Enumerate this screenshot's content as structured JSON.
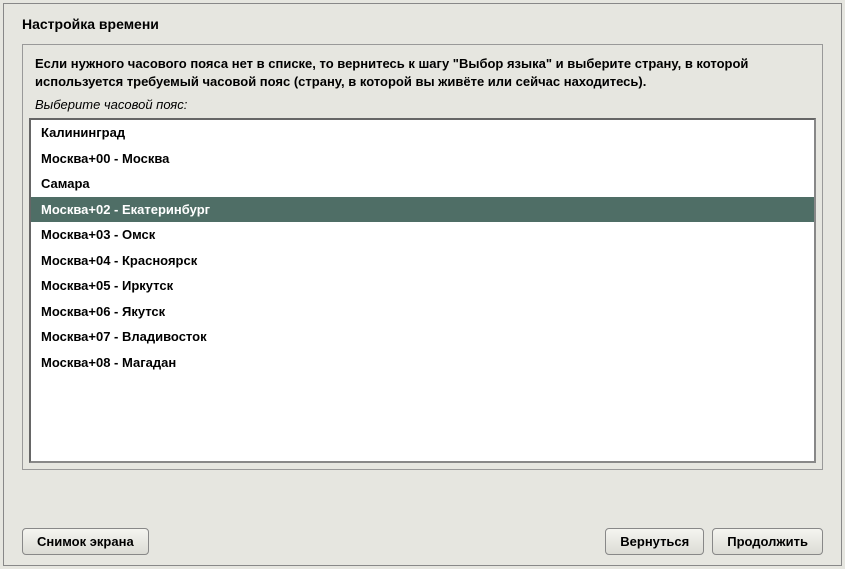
{
  "dialog": {
    "title": "Настройка времени",
    "help": "Если нужного часового пояса нет в списке, то вернитесь к шагу \"Выбор языка\" и выберите страну, в которой используется требуемый часовой пояс (страну, в которой вы живёте или сейчас находитесь).",
    "prompt": "Выберите часовой пояс:"
  },
  "list": {
    "items": [
      {
        "label": "Калининград",
        "selected": false
      },
      {
        "label": "Москва+00 - Москва",
        "selected": false
      },
      {
        "label": "Самара",
        "selected": false
      },
      {
        "label": "Москва+02 - Екатеринбург",
        "selected": true
      },
      {
        "label": "Москва+03 - Омск",
        "selected": false
      },
      {
        "label": "Москва+04 - Красноярск",
        "selected": false
      },
      {
        "label": "Москва+05 - Иркутск",
        "selected": false
      },
      {
        "label": "Москва+06 - Якутск",
        "selected": false
      },
      {
        "label": "Москва+07 - Владивосток",
        "selected": false
      },
      {
        "label": "Москва+08 - Магадан",
        "selected": false
      }
    ]
  },
  "buttons": {
    "screenshot": "Снимок экрана",
    "back": "Вернуться",
    "continue": "Продолжить"
  }
}
